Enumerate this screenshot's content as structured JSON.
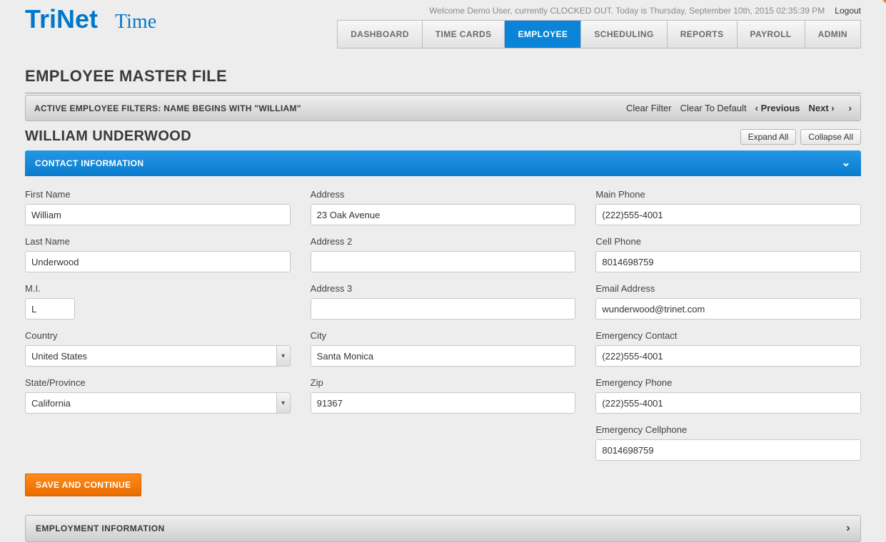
{
  "header": {
    "welcome_text": "Welcome Demo User, currently CLOCKED OUT. Today is Thursday, September 10th, 2015 02:35:39 PM",
    "logout": "Logout",
    "logo_primary": "TriNet",
    "logo_secondary": "Time"
  },
  "nav": {
    "items": [
      {
        "label": "DASHBOARD",
        "active": false
      },
      {
        "label": "TIME CARDS",
        "active": false
      },
      {
        "label": "EMPLOYEE",
        "active": true
      },
      {
        "label": "SCHEDULING",
        "active": false
      },
      {
        "label": "REPORTS",
        "active": false
      },
      {
        "label": "PAYROLL",
        "active": false
      },
      {
        "label": "ADMIN",
        "active": false
      }
    ]
  },
  "page_title": "EMPLOYEE MASTER FILE",
  "filter_bar": {
    "label": "ACTIVE EMPLOYEE FILTERS: NAME BEGINS WITH \"WILLIAM\"",
    "clear_filter": "Clear Filter",
    "clear_default": "Clear To Default",
    "previous": "Previous",
    "next": "Next"
  },
  "employee_name": "WILLIAM UNDERWOOD",
  "expand_all": "Expand All",
  "collapse_all": "Collapse All",
  "sections": {
    "contact_title": "CONTACT INFORMATION",
    "employment_title": "EMPLOYMENT INFORMATION"
  },
  "labels": {
    "first_name": "First Name",
    "last_name": "Last Name",
    "mi": "M.I.",
    "country": "Country",
    "state": "State/Province",
    "address": "Address",
    "address2": "Address 2",
    "address3": "Address 3",
    "city": "City",
    "zip": "Zip",
    "main_phone": "Main Phone",
    "cell_phone": "Cell Phone",
    "email": "Email Address",
    "emergency_contact": "Emergency Contact",
    "emergency_phone": "Emergency Phone",
    "emergency_cell": "Emergency Cellphone"
  },
  "values": {
    "first_name": "William",
    "last_name": "Underwood",
    "mi": "L",
    "country": "United States",
    "state": "California",
    "address": "23 Oak Avenue",
    "address2": "",
    "address3": "",
    "city": "Santa Monica",
    "zip": "91367",
    "main_phone": "(222)555-4001",
    "cell_phone": "8014698759",
    "email": "wunderwood@trinet.com",
    "emergency_contact": "(222)555-4001",
    "emergency_phone": "(222)555-4001",
    "emergency_cell": "8014698759"
  },
  "save_button": "SAVE AND CONTINUE"
}
